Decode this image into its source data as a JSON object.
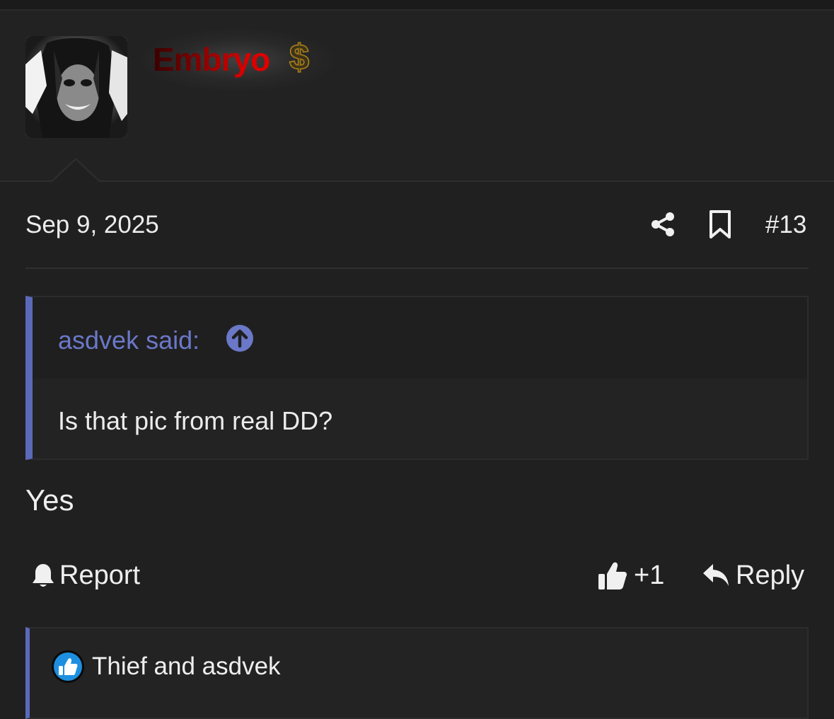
{
  "user": {
    "name": "Embryo",
    "badge_icon": "dollar-sign-icon",
    "avatar": "avatar-image",
    "name_gradient": [
      "#3a0000",
      "#e10000"
    ]
  },
  "post": {
    "date": "Sep 9, 2025",
    "number": "#13",
    "share_icon": "share-icon",
    "bookmark_icon": "bookmark-icon"
  },
  "quote": {
    "author_label": "asdvek said:",
    "jump_icon": "arrow-up-circle-icon",
    "text": "Is that pic from real DD?",
    "accent_color": "#5a69b8"
  },
  "message": {
    "text": "Yes"
  },
  "actions": {
    "report_label": "Report",
    "like_label": "+1",
    "reply_label": "Reply"
  },
  "reactions": {
    "icon": "thumbs-up-reaction-icon",
    "text": "Thief and asdvek"
  }
}
